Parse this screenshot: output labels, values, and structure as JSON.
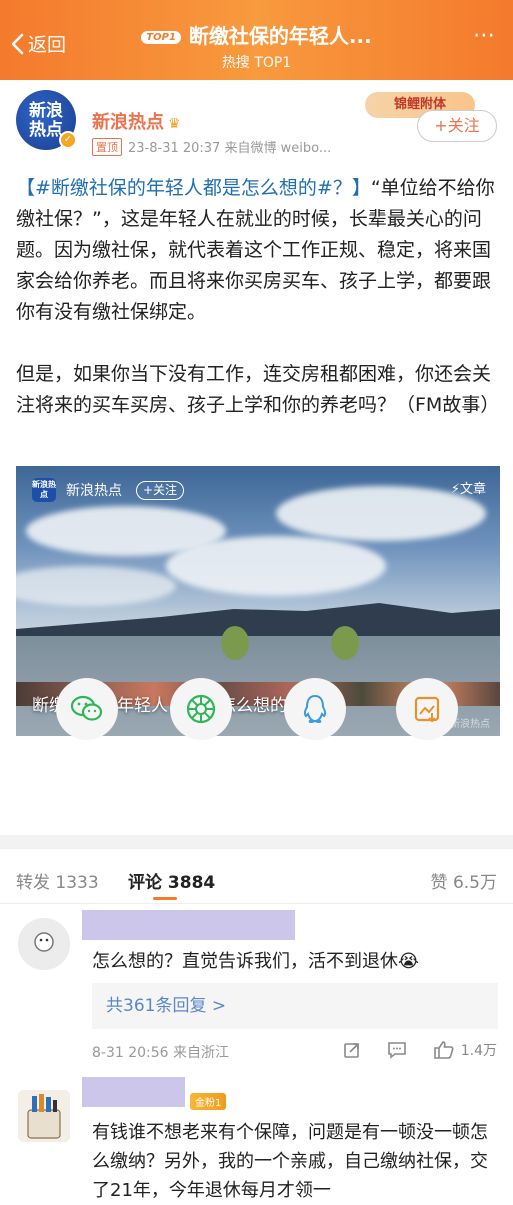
{
  "header": {
    "back_label": "返回",
    "badge": "TOP1",
    "title": "断缴社保的年轻人...",
    "subtitle": "热搜 TOP1"
  },
  "post": {
    "author": "新浪热点",
    "avatar_text": "新浪热点",
    "pin_label": "置顶",
    "meta": "23-8-31 20:37  来自微博 weibo...",
    "koi_label": "锦鲤附体",
    "follow_label": "+关注",
    "hashtag": "【#断缴社保的年轻人都是怎么想的#？】",
    "para1_rest": "“单位给不给你缴社保？”，这是年轻人在就业的时候，长辈最关心的问题。因为缴社保，就代表着这个工作正规、稳定，将来国家会给你养老。而且将来你买房买车、孩子上学，都要跟你有没有缴社保绑定。",
    "para2": "但是，如果你当下没有工作，连交房租都困难，你还会关注将来的买车买房、孩子上学和你的养老吗？（FM故事）"
  },
  "media": {
    "channel": "新浪热点",
    "logo_text": "新浪热点",
    "follow_label": "+关注",
    "article_label": "⚡文章",
    "caption": "断缴社保的年轻人，都是怎么想的？",
    "watermark": "@新浪热点"
  },
  "share": {
    "icons": [
      "wechat-icon",
      "moments-icon",
      "qq-icon",
      "save-image-icon"
    ],
    "wechat_color": "#2fb65b",
    "moments_color": "#2fb65b",
    "qq_color": "#3a9bdc",
    "save_color": "#e8922e"
  },
  "tabs": {
    "repost": "转发 1333",
    "comments": "评论 3884",
    "likes": "赞 6.5万"
  },
  "comment1": {
    "text": "怎么想的？直觉告诉我们，活不到退休😭",
    "replies": "共361条回复 >",
    "meta": "8-31 20:56 来自浙江",
    "likes": "1.4万"
  },
  "comment2": {
    "fan_badge": "金粉1",
    "text": "有钱谁不想老来有个保障，问题是有一顿没一顿怎么缴纳？另外，我的一个亲戚，自己缴纳社保，交了21年，今年退休每月才领一"
  }
}
